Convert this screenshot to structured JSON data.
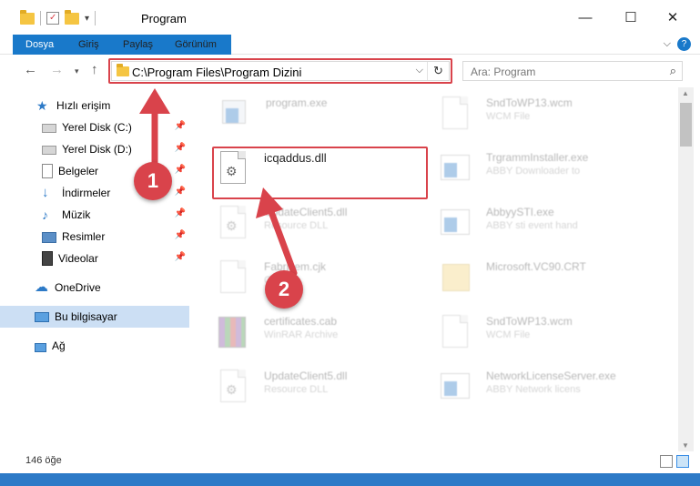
{
  "window": {
    "title": "Program",
    "minimize_glyph": "—",
    "maximize_glyph": "☐",
    "close_glyph": "✕"
  },
  "ribbon": {
    "tabs": [
      "Dosya",
      "Giriş",
      "Paylaş",
      "Görünüm"
    ],
    "help_glyph": "?"
  },
  "address": {
    "path": "C:\\Program Files\\Program Dizini",
    "dropdown_glyph": "⌵",
    "refresh_glyph": "↻"
  },
  "search": {
    "placeholder": "Ara: Program",
    "icon": "search-icon"
  },
  "sidebar": {
    "items": [
      {
        "label": "Hızlı erişim",
        "icon": "star-icon"
      },
      {
        "label": "Yerel Disk (C:)",
        "icon": "drive-icon"
      },
      {
        "label": "Yerel Disk (D:)",
        "icon": "drive-icon"
      },
      {
        "label": "Belgeler",
        "icon": "documents-icon"
      },
      {
        "label": "İndirmeler",
        "icon": "download-icon"
      },
      {
        "label": "Müzik",
        "icon": "music-icon"
      },
      {
        "label": "Resimler",
        "icon": "pictures-icon"
      },
      {
        "label": "Videolar",
        "icon": "videos-icon"
      },
      {
        "label": "OneDrive",
        "icon": "cloud-icon"
      },
      {
        "label": "Bu bilgisayar",
        "icon": "computer-icon"
      },
      {
        "label": "Ağ",
        "icon": "network-icon"
      }
    ]
  },
  "files": [
    {
      "name": "program.exe",
      "sub": ""
    },
    {
      "name": "SndToWP13.wcm",
      "sub": "WCM File"
    },
    {
      "name": "icqaddus.dll",
      "sub": ""
    },
    {
      "name": "TrgrammInstaller.exe",
      "sub": "ABBY Downloader to"
    },
    {
      "name": "UpdateClient5.dll",
      "sub": "Resource DLL"
    },
    {
      "name": "AbbyySTI.exe",
      "sub": "ABBY sti event hand"
    },
    {
      "name": "Fabricem.cjk",
      "sub": "CJK"
    },
    {
      "name": "Microsoft.VC90.CRT",
      "sub": ""
    },
    {
      "name": "certificates.cab",
      "sub": "WinRAR Archive"
    },
    {
      "name": "SndToWP13.wcm",
      "sub": "WCM File"
    },
    {
      "name": "UpdateClient5.dll",
      "sub": "Resource DLL"
    },
    {
      "name": "NetworkLicenseServer.exe",
      "sub": "ABBY Network licens"
    }
  ],
  "status": {
    "count": "146 öğe"
  },
  "annotations": {
    "step1": "1",
    "step2": "2",
    "highlight_color": "#d9434b"
  },
  "colors": {
    "accent": "#1979ca",
    "selection": "#ccdff4"
  }
}
